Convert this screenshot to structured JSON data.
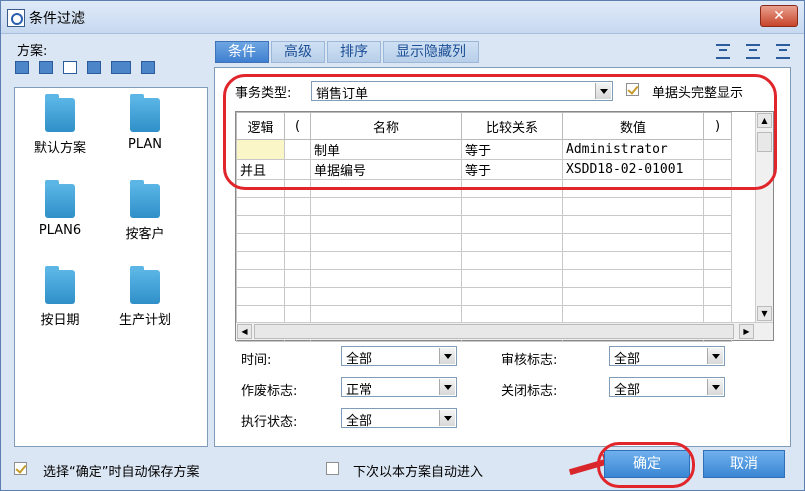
{
  "window": {
    "title": "条件过滤",
    "close": "✕"
  },
  "left": {
    "scheme_label": "方案:",
    "schemes": [
      "默认方案",
      "PLAN",
      "PLAN6",
      "按客户",
      "按日期",
      "生产计划"
    ]
  },
  "tabs": [
    "条件",
    "高级",
    "排序",
    "显示隐藏列"
  ],
  "filter": {
    "biz_type_label": "事务类型:",
    "biz_type_value": "销售订单",
    "full_header_label": "单据头完整显示",
    "columns": [
      "逻辑",
      "(",
      "名称",
      "比较关系",
      "数值",
      ")"
    ],
    "rows": [
      {
        "logic": "",
        "lp": "",
        "name": "制单",
        "op": "等于",
        "value": "Administrator",
        "rp": ""
      },
      {
        "logic": "并且",
        "lp": "",
        "name": "单据编号",
        "op": "等于",
        "value": "XSDD18-02-01001",
        "rp": ""
      }
    ]
  },
  "fields": {
    "time_label": "时间:",
    "time_value": "全部",
    "audit_label": "审核标志:",
    "audit_value": "全部",
    "void_label": "作废标志:",
    "void_value": "正常",
    "close_label": "关闭标志:",
    "close_value": "全部",
    "exec_label": "执行状态:",
    "exec_value": "全部"
  },
  "footer": {
    "auto_save_label": "选择“确定”时自动保存方案",
    "auto_enter_label": "下次以本方案自动进入",
    "ok_label": "确定",
    "cancel_label": "取消"
  },
  "colors": {
    "accent": "#3f7fd0",
    "highlight": "#e0252b"
  }
}
